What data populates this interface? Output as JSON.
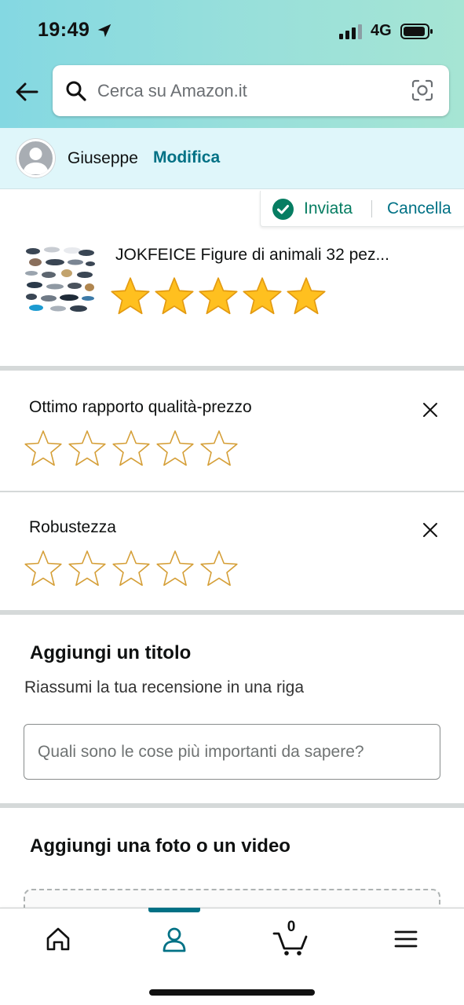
{
  "status_bar": {
    "time": "19:49",
    "network": "4G"
  },
  "search": {
    "placeholder": "Cerca su Amazon.it"
  },
  "user": {
    "name": "Giuseppe",
    "edit_label": "Modifica"
  },
  "review_status": {
    "sent_label": "Inviata",
    "cancel_label": "Cancella"
  },
  "product": {
    "title": "JOKFEICE Figure di animali 32 pez...",
    "rating": 5,
    "max_rating": 5
  },
  "attributes": [
    {
      "label": "Ottimo rapporto qualità-prezzo",
      "rating": 0
    },
    {
      "label": "Robustezza",
      "rating": 0
    }
  ],
  "title_section": {
    "heading": "Aggiungi un titolo",
    "subheading": "Riassumi la tua recensione in una riga",
    "input_placeholder": "Quali sono le cose più importanti da sapere?",
    "input_value": ""
  },
  "media_section": {
    "heading": "Aggiungi una foto o un video"
  },
  "bottom_nav": {
    "cart_count": "0",
    "active_tab": "account"
  },
  "colors": {
    "accent_teal": "#007185",
    "success_green": "#067d62",
    "star_fill": "#ffc01f",
    "star_outline": "#d59f38"
  }
}
